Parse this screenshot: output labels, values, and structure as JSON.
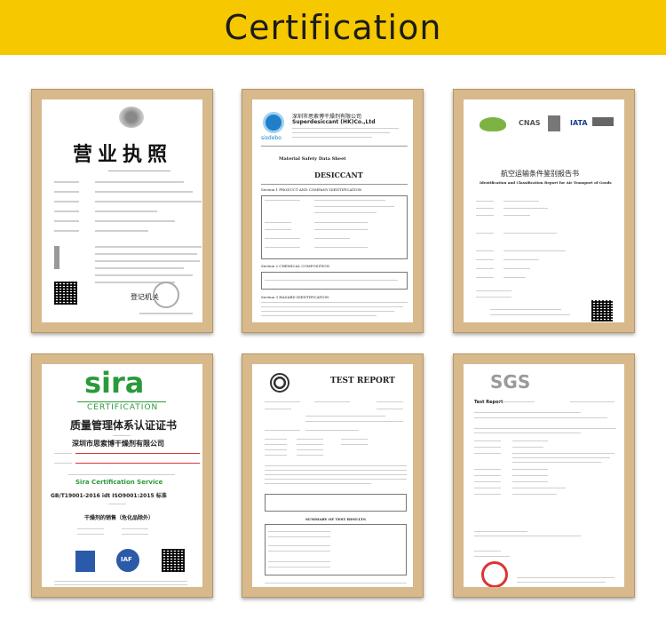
{
  "banner": {
    "title": "Certification"
  },
  "cert1": {
    "heading": "营业执照",
    "reg_label": "登记机关"
  },
  "cert2": {
    "company": "深圳市思索博干燥剂有限公司",
    "company_en": "Superdesiccant (HK)Co.,Ltd",
    "logo_text": "sisdebo",
    "sheet_title": "Material Safety Data Sheet",
    "doc_title": "DESICCANT",
    "section1": "Section 1 PRODUCT AND COMPANY IDENTIFICATION",
    "section2": "Section 2 CHEMICAL COMPOSITION",
    "section3": "Section 3 HAZARD IDENTIFICATION"
  },
  "cert3": {
    "title": "航空运输条件鉴别报告书",
    "subtitle": "Identification and Classification Report for Air Transport of Goods",
    "logo_cnas": "CNAS",
    "logo_iata": "IATA"
  },
  "cert4": {
    "logo": "sira",
    "logo_sub": "CERTIFICATION",
    "title": "质量管理体系认证证书",
    "company": "深圳市思索博干燥剂有限公司",
    "service": "Sira Certification Service",
    "standard": "GB/T19001-2016 idt ISO9001:2015 标准",
    "scope": "干燥剂的销售（危化品除外）",
    "logo_iaf": "IAF"
  },
  "cert5": {
    "title": "TEST REPORT",
    "summary": "SUMMARY OF TEST RESULTS"
  },
  "cert6": {
    "logo": "SGS",
    "report_label": "Test Report"
  }
}
